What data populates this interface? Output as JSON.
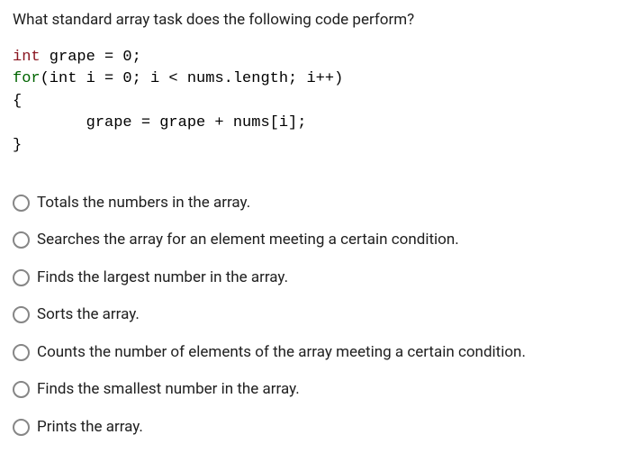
{
  "question": "What standard array task does the following code perform?",
  "code": {
    "line1_kw": "int",
    "line1_rest": " grape = 0;",
    "line2_kw": "for",
    "line2_rest": "(int i = 0; i < nums.length; i++)",
    "line3": "{",
    "line4": "        grape = grape + nums[i];",
    "line5": "}"
  },
  "options": [
    {
      "label": "Totals the numbers in the array."
    },
    {
      "label": "Searches the array for an element meeting a certain condition."
    },
    {
      "label": "Finds the largest number in the array."
    },
    {
      "label": "Sorts the array."
    },
    {
      "label": "Counts the number of elements of the array meeting a certain condition."
    },
    {
      "label": "Finds the smallest number in the array."
    },
    {
      "label": "Prints the array."
    }
  ]
}
